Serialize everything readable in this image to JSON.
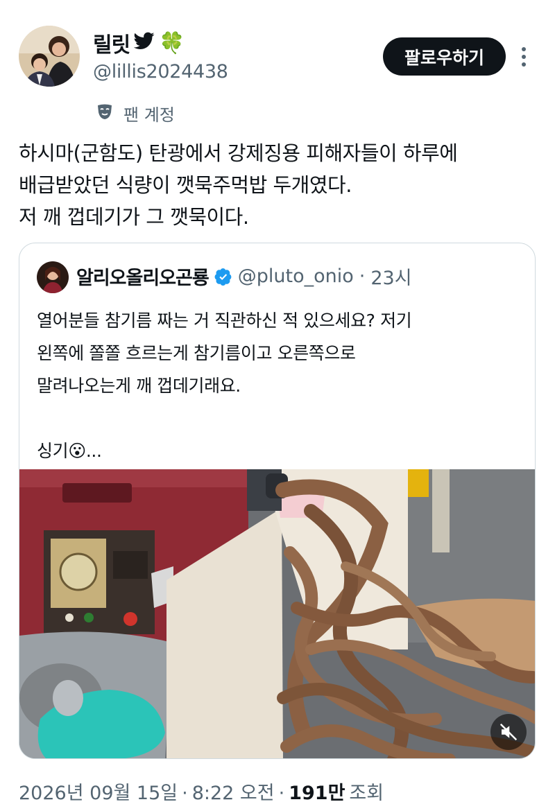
{
  "author": {
    "display_name": "릴릿",
    "display_name_emoji": "🍀",
    "handle": "@lillis2024438",
    "badge_label": "팬 계정",
    "follow_label": "팔로우하기"
  },
  "tweet": {
    "lines": [
      "하시마(군함도) 탄광에서 강제징용 피해자들이 하루에",
      "배급받았던 식량이 깻묵주먹밥 두개였다.",
      "저 깨 껍데기가 그 깻묵이다."
    ]
  },
  "quoted": {
    "display_name": "알리오올리오곤룡",
    "handle": "@pluto_onio",
    "separator": "·",
    "time": "23시",
    "lines": [
      "열어분들 참기름 짜는 거 직관하신 적 있으세요? 저기",
      "왼쪽에 쫄쫄 흐르는게 참기름이고 오른쪽으로",
      "말려나오는게 깨 껍데기래요.",
      "",
      "싱기"
    ],
    "last_line_emoji": "😮",
    "last_line_suffix": "..."
  },
  "meta": {
    "date": "2026년 09월 15일",
    "sep1": "·",
    "time": "8:22 오전",
    "sep2": "·",
    "views_count": "191만",
    "views_label": "조회"
  },
  "colors": {
    "text_primary": "#0f1419",
    "text_secondary": "#536471",
    "verified_blue": "#1d9bf0",
    "follow_bg": "#0f1419",
    "border": "#cfd9de"
  }
}
